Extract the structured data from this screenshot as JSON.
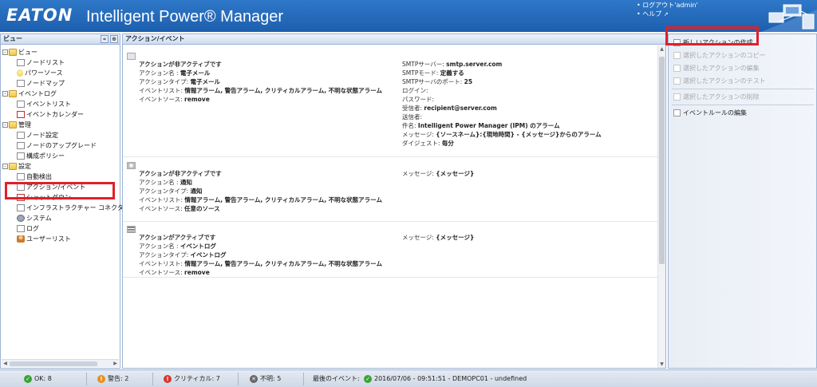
{
  "header": {
    "logo": "EATON",
    "app_title": "Intelligent Power® Manager",
    "logout": "ログアウト'admin'",
    "help": "ヘルプ"
  },
  "left_panel": {
    "title": "ビュー",
    "tree": [
      {
        "label": "ビュー",
        "level": 1,
        "icon": "folder-icon",
        "expand": "-"
      },
      {
        "label": "ノードリスト",
        "level": 2,
        "icon": "page-icon"
      },
      {
        "label": "パワーソース",
        "level": 2,
        "icon": "bulb-icon"
      },
      {
        "label": "ノードマップ",
        "level": 2,
        "icon": "map-icon"
      },
      {
        "label": "イベントログ",
        "level": 1,
        "icon": "folder-icon",
        "expand": "-"
      },
      {
        "label": "イベントリスト",
        "level": 2,
        "icon": "page-icon"
      },
      {
        "label": "イベントカレンダー",
        "level": 2,
        "icon": "calendar-icon"
      },
      {
        "label": "管理",
        "level": 1,
        "icon": "folder-icon",
        "expand": "-"
      },
      {
        "label": "ノード設定",
        "level": 2,
        "icon": "settings-page-icon"
      },
      {
        "label": "ノードのアップグレード",
        "level": 2,
        "icon": "upgrade-icon"
      },
      {
        "label": "構成ポリシー",
        "level": 2,
        "icon": "policy-icon"
      },
      {
        "label": "設定",
        "level": 1,
        "icon": "folder-icon",
        "expand": "-"
      },
      {
        "label": "自動検出",
        "level": 2,
        "icon": "search-icon"
      },
      {
        "label": "アクション/イベント",
        "level": 2,
        "icon": "action-icon"
      },
      {
        "label": "シャットダウン",
        "level": 2,
        "icon": "shutdown-icon"
      },
      {
        "label": "インフラストラクチャー コネクター",
        "level": 2,
        "icon": "connector-icon"
      },
      {
        "label": "システム",
        "level": 2,
        "icon": "gear-icon"
      },
      {
        "label": "ログ",
        "level": 2,
        "icon": "log-icon"
      },
      {
        "label": "ユーザーリスト",
        "level": 2,
        "icon": "user-icon"
      }
    ]
  },
  "center_panel": {
    "title": "アクション/イベント",
    "actions": [
      {
        "icon": "email-icon",
        "left": [
          {
            "k": "アクションが非アクティブです",
            "v": ""
          },
          {
            "k": "アクション名 : ",
            "v": "電子メール"
          },
          {
            "k": "アクションタイプ: ",
            "v": "電子メール"
          },
          {
            "k": "イベントリスト: ",
            "v": "情報アラーム, 警告アラーム, クリティカルアラーム, 不明な状態アラーム"
          },
          {
            "k": "イベントソース: ",
            "v": "remove"
          }
        ],
        "right": [
          {
            "k": "SMTPサーバー: ",
            "v": "smtp.server.com"
          },
          {
            "k": "SMTPモード: ",
            "v": "定義する"
          },
          {
            "k": "SMTPサーバのポート: ",
            "v": "25"
          },
          {
            "k": "ログイン: ",
            "v": ""
          },
          {
            "k": "パスワード: ",
            "v": ""
          },
          {
            "k": "受信者: ",
            "v": "recipient@server.com"
          },
          {
            "k": "送信者: ",
            "v": ""
          },
          {
            "k": "件名: ",
            "v": "Intelligent Power Manager (IPM) のアラーム"
          },
          {
            "k": "メッセージ: ",
            "v": "{ソースネーム}:{現地時間} - {メッセージ}からのアラーム"
          },
          {
            "k": "ダイジェスト: ",
            "v": "毎分"
          }
        ]
      },
      {
        "icon": "notification-icon",
        "left": [
          {
            "k": "アクションが非アクティブです",
            "v": ""
          },
          {
            "k": "アクション名 : ",
            "v": "通知"
          },
          {
            "k": "アクションタイプ: ",
            "v": "通知"
          },
          {
            "k": "イベントリスト: ",
            "v": "情報アラーム, 警告アラーム, クリティカルアラーム, 不明な状態アラーム"
          },
          {
            "k": "イベントソース: ",
            "v": "任意のソース"
          }
        ],
        "right": [
          {
            "k": "メッセージ: ",
            "v": "{メッセージ}"
          }
        ]
      },
      {
        "icon": "event-log-icon",
        "left": [
          {
            "k": "アクションがアクティブです",
            "v": ""
          },
          {
            "k": "アクション名 : ",
            "v": "イベントログ"
          },
          {
            "k": "アクションタイプ: ",
            "v": "イベントログ"
          },
          {
            "k": "イベントリスト: ",
            "v": "情報アラーム, 警告アラーム, クリティカルアラーム, 不明な状態アラーム"
          },
          {
            "k": "イベントソース: ",
            "v": "remove"
          }
        ],
        "right": [
          {
            "k": "メッセージ: ",
            "v": "{メッセージ}"
          }
        ]
      }
    ]
  },
  "right_panel": {
    "actions": [
      {
        "label": "新しいアクションの作成",
        "enabled": true
      },
      {
        "label": "選択したアクションのコピー",
        "enabled": false
      },
      {
        "label": "選択したアクションの編集",
        "enabled": false
      },
      {
        "label": "選択したアクションのテスト",
        "enabled": false
      },
      {
        "label": "選択したアクションの削除",
        "enabled": false
      },
      {
        "label": "イベントルールの編集",
        "enabled": true
      }
    ]
  },
  "statusbar": {
    "ok": "OK: 8",
    "warning": "警告: 2",
    "critical": "クリティカル: 7",
    "unknown": "不明: 5",
    "last_event_label": "最後のイベント:",
    "last_event": "2016/07/06 - 09:51:51 - DEMOPC01 - undefined"
  },
  "colors": {
    "header_blue": "#1d5fae",
    "highlight_red": "#e0202a",
    "ok_green": "#3aa335",
    "warning_orange": "#e8901a",
    "critical_red": "#d9342b",
    "unknown_gray": "#666666"
  }
}
